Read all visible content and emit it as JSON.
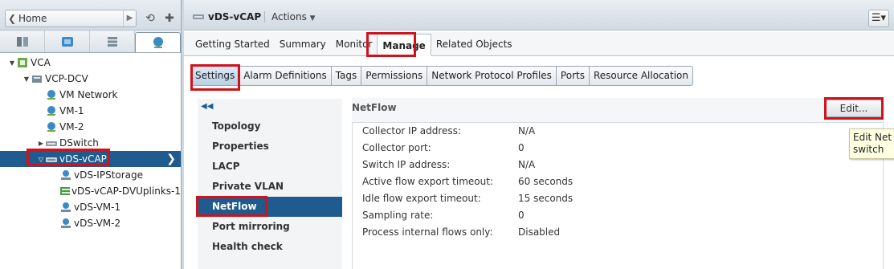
{
  "navigator": {
    "home_label": "Home",
    "tree": [
      {
        "label": "VCA",
        "level": 0,
        "twisty": "▼",
        "icon": "vcenter-icon",
        "color": "#6fa84a"
      },
      {
        "label": "VCP-DCV",
        "level": 1,
        "twisty": "▼",
        "icon": "datacenter-icon",
        "color": "#7a8a96"
      },
      {
        "label": "VM Network",
        "level": 2,
        "twisty": "",
        "icon": "network-icon",
        "color": "#3a8ac6"
      },
      {
        "label": "VM-1",
        "level": 2,
        "twisty": "",
        "icon": "network-icon",
        "color": "#3a8ac6"
      },
      {
        "label": "VM-2",
        "level": 2,
        "twisty": "",
        "icon": "network-icon",
        "color": "#3a8ac6"
      },
      {
        "label": "DSwitch",
        "level": 2,
        "twisty": "▶",
        "icon": "dswitch-icon",
        "color": "#8a9aa6"
      },
      {
        "label": "vDS-vCAP",
        "level": 2,
        "twisty": "▽",
        "icon": "dswitch-icon",
        "color": "#8a9aa6",
        "selected": true
      },
      {
        "label": "vDS-IPStorage",
        "level": 3,
        "twisty": "",
        "icon": "portgroup-icon",
        "color": "#3a8ac6"
      },
      {
        "label": "vDS-vCAP-DVUplinks-1",
        "level": 3,
        "twisty": "",
        "icon": "uplink-icon",
        "color": "#4a9a4a"
      },
      {
        "label": "vDS-VM-1",
        "level": 3,
        "twisty": "",
        "icon": "portgroup-icon",
        "color": "#3a8ac6"
      },
      {
        "label": "vDS-VM-2",
        "level": 3,
        "twisty": "",
        "icon": "portgroup-icon",
        "color": "#3a8ac6"
      }
    ]
  },
  "header": {
    "object_title": "vDS-vCAP",
    "actions_label": "Actions"
  },
  "main_tabs": [
    "Getting Started",
    "Summary",
    "Monitor",
    "Manage",
    "Related Objects"
  ],
  "sub_tabs": [
    "Settings",
    "Alarm Definitions",
    "Tags",
    "Permissions",
    "Network Protocol Profiles",
    "Ports",
    "Resource Allocation"
  ],
  "side_nav": [
    "Topology",
    "Properties",
    "LACP",
    "Private VLAN",
    "NetFlow",
    "Port mirroring",
    "Health check"
  ],
  "netflow": {
    "title": "NetFlow",
    "edit_label": "Edit...",
    "tooltip_line1": "Edit Net",
    "tooltip_line2": "switch",
    "rows": [
      {
        "key": "Collector IP address:",
        "value": "N/A"
      },
      {
        "key": "Collector port:",
        "value": "0"
      },
      {
        "key": "Switch IP address:",
        "value": "N/A"
      },
      {
        "key": "Active flow export timeout:",
        "value": "60 seconds"
      },
      {
        "key": "Idle flow export timeout:",
        "value": "15 seconds"
      },
      {
        "key": "Sampling rate:",
        "value": "0"
      },
      {
        "key": "Process internal flows only:",
        "value": "Disabled"
      }
    ]
  },
  "colors": {
    "accent": "#1f5b8f",
    "highlight": "#d0121b"
  }
}
